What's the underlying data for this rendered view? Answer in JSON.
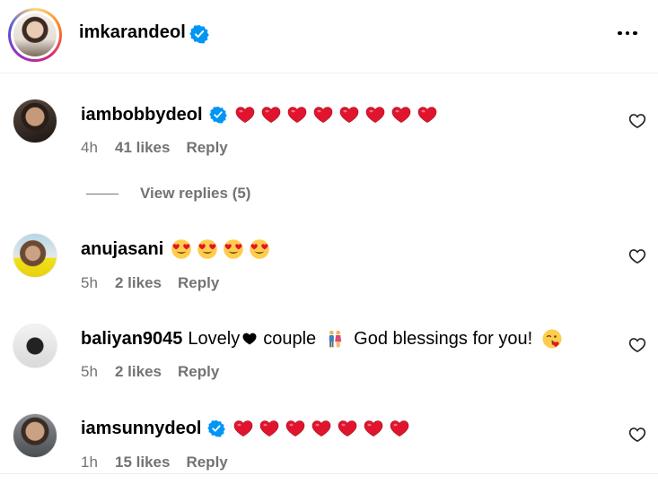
{
  "header": {
    "username": "imkarandeol",
    "verified": true,
    "more_icon": "more-horizontal-icon"
  },
  "comments": [
    {
      "username": "iambobbydeol",
      "verified": true,
      "text": "",
      "emoji": "red-heart",
      "emoji_count": 8,
      "time": "4h",
      "likes": "41 likes",
      "reply": "Reply"
    },
    {
      "username": "anujasani",
      "verified": false,
      "text": "",
      "emoji": "smiling-face-with-heart-eyes",
      "emoji_count": 4,
      "time": "5h",
      "likes": "2 likes",
      "reply": "Reply"
    },
    {
      "username": "baliyan9045",
      "verified": false,
      "text_a": "Lovely",
      "text_b": "couple",
      "text_c": "God blessings for you!",
      "time": "5h",
      "likes": "2 likes",
      "reply": "Reply"
    },
    {
      "username": "iamsunnydeol",
      "verified": true,
      "text": "",
      "emoji": "red-heart",
      "emoji_count": 7,
      "time": "1h",
      "likes": "15 likes",
      "reply": "Reply"
    }
  ],
  "view_replies": "View replies (5)",
  "colors": {
    "verified_blue": "#0095f6",
    "secondary_text": "#737373",
    "heart_red": "#e0152d"
  }
}
